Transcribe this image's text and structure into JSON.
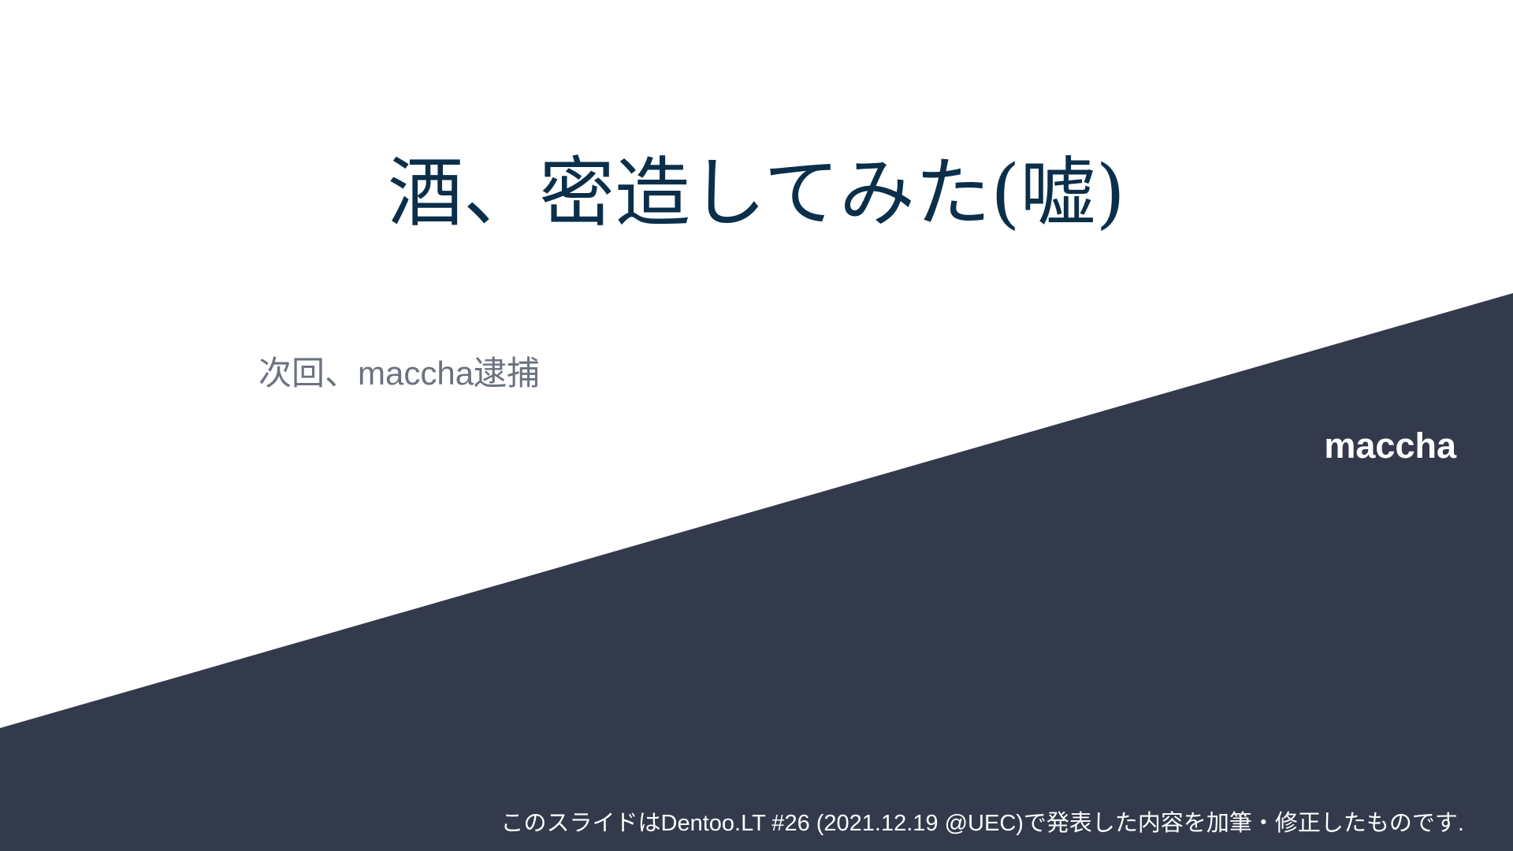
{
  "slide": {
    "title": "酒、密造してみた(嘘)",
    "subtitle": "次回、maccha逮捕",
    "author": "maccha",
    "footer": "このスライドはDentoo.LT #26 (2021.12.19 @UEC)で発表した内容を加筆・修正したものです."
  },
  "colors": {
    "background": "#ffffff",
    "band": "#333a4b",
    "title": "#0b2f4a",
    "subtitle": "#6b7280",
    "on_band_text": "#ffffff"
  }
}
